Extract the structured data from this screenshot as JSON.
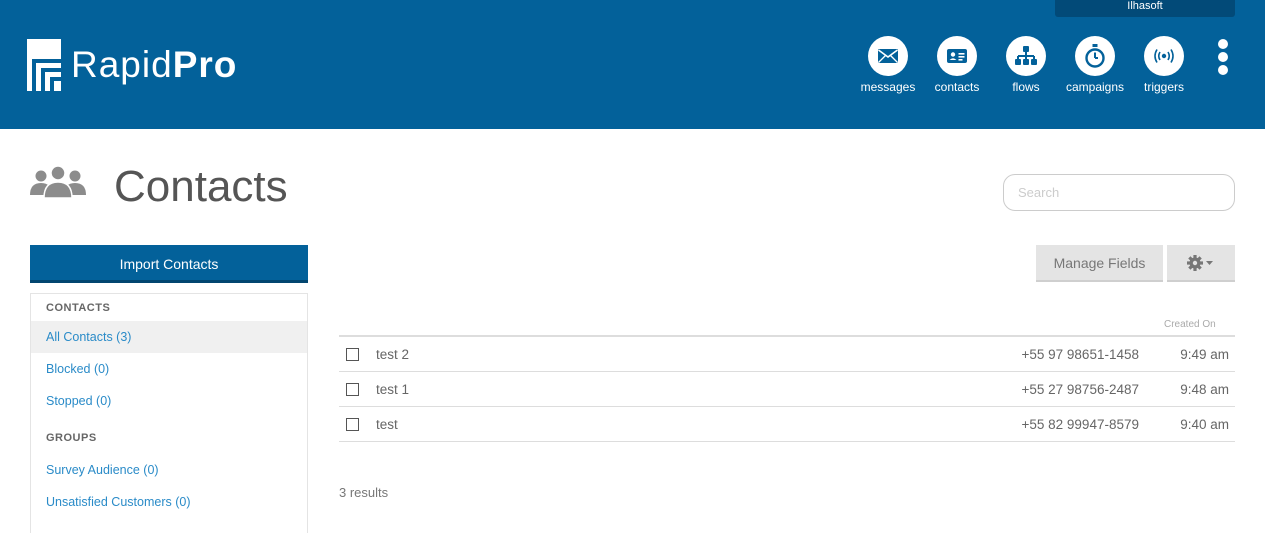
{
  "header": {
    "org_name": "Ilhasoft",
    "logo": {
      "text_light": "Rapid",
      "text_bold": "Pro"
    },
    "nav": [
      {
        "label": "messages",
        "icon": "envelope-icon"
      },
      {
        "label": "contacts",
        "icon": "contact-card-icon"
      },
      {
        "label": "flows",
        "icon": "flow-tree-icon"
      },
      {
        "label": "campaigns",
        "icon": "stopwatch-icon"
      },
      {
        "label": "triggers",
        "icon": "broadcast-icon"
      }
    ],
    "more_icon": "more-vertical-icon"
  },
  "page": {
    "title": "Contacts",
    "title_icon": "contacts-group-icon",
    "search_placeholder": "Search"
  },
  "sidebar": {
    "import_label": "Import Contacts",
    "contacts_header": "CONTACTS",
    "contacts_items": [
      {
        "label": "All Contacts (3)",
        "active": true
      },
      {
        "label": "Blocked (0)",
        "active": false
      },
      {
        "label": "Stopped (0)",
        "active": false
      }
    ],
    "groups_header": "GROUPS",
    "groups_items": [
      {
        "label": "Survey Audience (0)"
      },
      {
        "label": "Unsatisfied Customers (0)"
      }
    ]
  },
  "toolbar": {
    "manage_fields_label": "Manage Fields",
    "gear_icon": "gear-dropdown-icon"
  },
  "table": {
    "created_header": "Created On",
    "rows": [
      {
        "name": "test 2",
        "phone": "+55 97 98651-1458",
        "created": "9:49 am"
      },
      {
        "name": "test 1",
        "phone": "+55 27 98756-2487",
        "created": "9:48 am"
      },
      {
        "name": "test",
        "phone": "+55 82 99947-8579",
        "created": "9:40 am"
      }
    ],
    "results_text": "3 results"
  },
  "colors": {
    "brand": "#03619a",
    "link": "#2a8bc8"
  }
}
